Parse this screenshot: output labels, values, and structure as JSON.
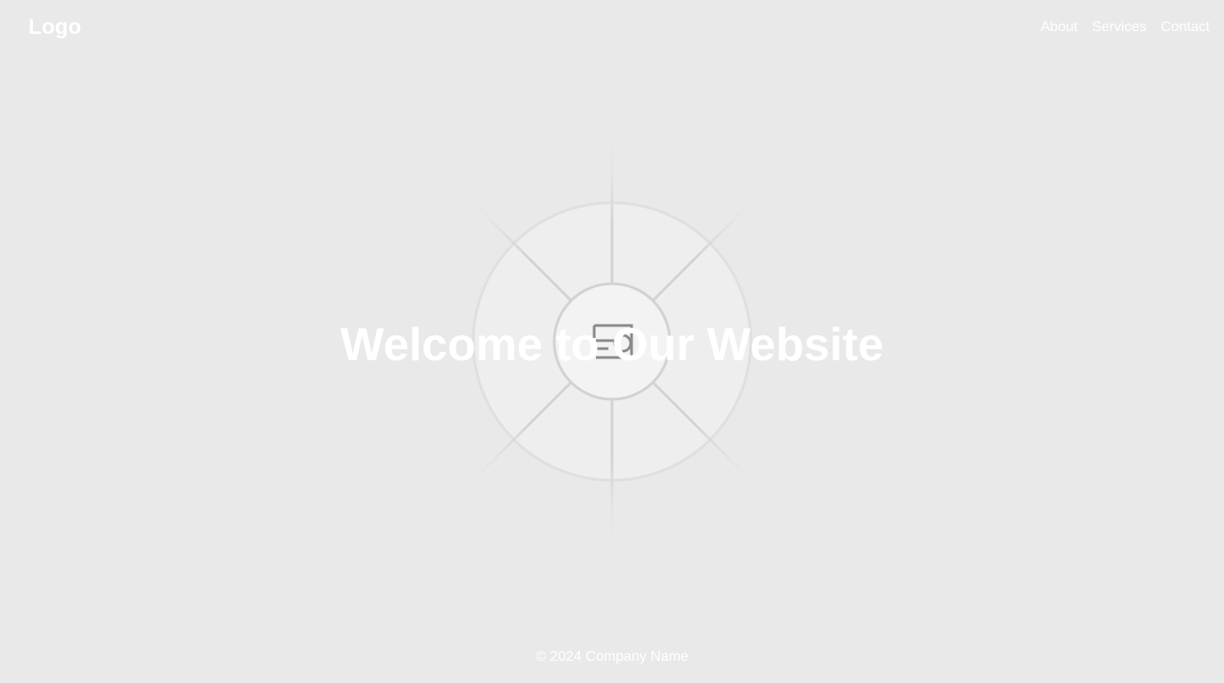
{
  "header": {
    "logo_text": "Logo",
    "nav": [
      {
        "label": "About"
      },
      {
        "label": "Services"
      },
      {
        "label": "Contact"
      }
    ]
  },
  "hero": {
    "title": "Welcome to Our Website",
    "graphic_icon": "image-placeholder-icon"
  },
  "footer": {
    "copyright": "© 2024 Company Name"
  },
  "colors": {
    "background": "#e9e9e9",
    "text": "#ffffff",
    "graphic_line": "#d4d4d4",
    "graphic_fill": "#efefef",
    "icon": "#8a8a8a"
  }
}
